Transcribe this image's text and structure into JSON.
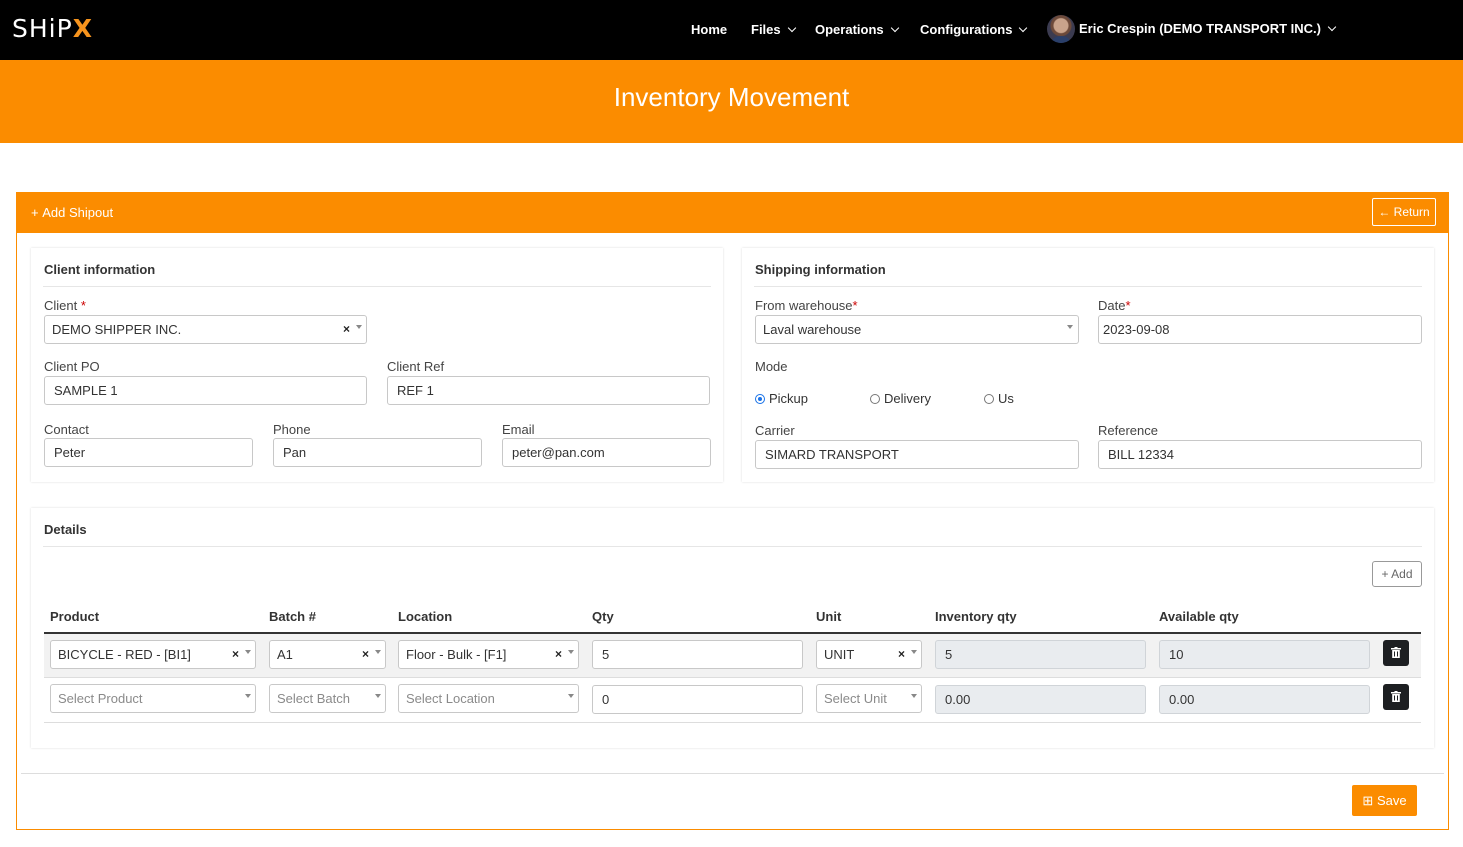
{
  "nav": {
    "logo_main": "SHiP",
    "logo_accent": "X",
    "items": [
      "Home",
      "Files",
      "Operations",
      "Configurations"
    ],
    "user": "Eric Crespin (DEMO TRANSPORT INC.)"
  },
  "page": {
    "title": "Inventory Movement",
    "card_title": "Add Shipout",
    "return_label": "Return",
    "save_label": "Save"
  },
  "client": {
    "section_title": "Client information",
    "client_label": "Client",
    "client_value": "DEMO SHIPPER INC.",
    "po_label": "Client PO",
    "po_value": "SAMPLE 1",
    "ref_label": "Client Ref",
    "ref_value": "REF 1",
    "contact_label": "Contact",
    "contact_value": "Peter",
    "phone_label": "Phone",
    "phone_value": "Pan",
    "email_label": "Email",
    "email_value": "peter@pan.com"
  },
  "shipping": {
    "section_title": "Shipping information",
    "warehouse_label": "From warehouse",
    "warehouse_value": "Laval warehouse",
    "date_label": "Date",
    "date_value": "2023-09-08",
    "mode_label": "Mode",
    "modes": [
      "Pickup",
      "Delivery",
      "Us"
    ],
    "mode_selected": "Pickup",
    "carrier_label": "Carrier",
    "carrier_value": "SIMARD TRANSPORT",
    "reference_label": "Reference",
    "reference_value": "BILL 12334"
  },
  "details": {
    "section_title": "Details",
    "add_label": "Add",
    "columns": [
      "Product",
      "Batch #",
      "Location",
      "Qty",
      "Unit",
      "Inventory qty",
      "Available qty"
    ],
    "rows": [
      {
        "product": "BICYCLE - RED - [BI1]",
        "batch": "A1",
        "location": "Floor - Bulk - [F1]",
        "qty": "5",
        "unit": "UNIT",
        "inventory_qty": "5",
        "available_qty": "10"
      },
      {
        "product": "Select Product",
        "batch": "Select Batch",
        "location": "Select Location",
        "qty": "0",
        "unit": "Select Unit",
        "inventory_qty": "0.00",
        "available_qty": "0.00"
      }
    ]
  }
}
